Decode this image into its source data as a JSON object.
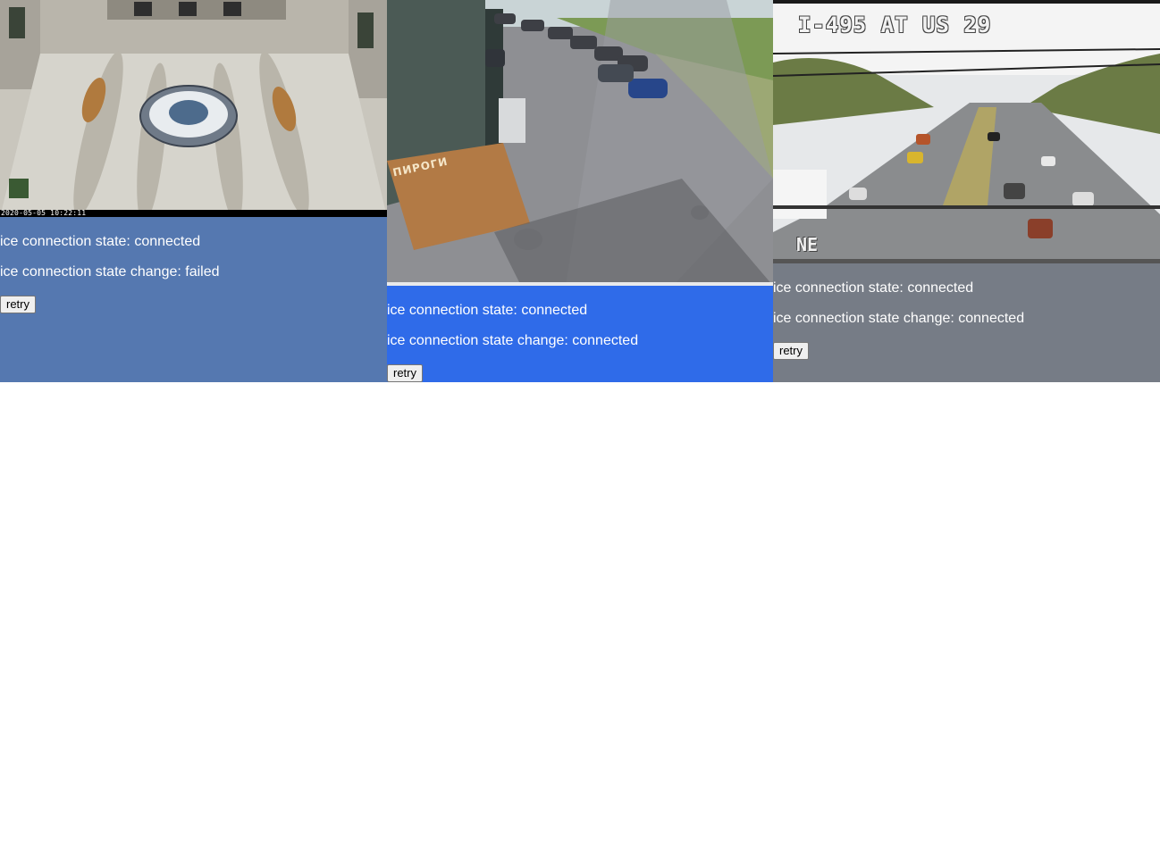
{
  "panels": [
    {
      "background": "#5578b0",
      "camera_scene": "station-hall-interior",
      "overlay": {
        "timestamp": "2020-05-05 10:22:11"
      },
      "state_text": "ice connection state: connected",
      "change_text": "ice connection state change: failed",
      "retry_label": "retry"
    },
    {
      "background": "#2f6be9",
      "camera_scene": "parking-lot-with-cars",
      "overlay": {
        "sign_text": "ПИРОГИ"
      },
      "state_text": "ice connection state: connected",
      "change_text": "ice connection state change: connected",
      "retry_label": "retry"
    },
    {
      "background": "#767c86",
      "camera_scene": "highway-traffic",
      "overlay": {
        "title": "I-495 AT US 29",
        "direction": "NE"
      },
      "state_text": "ice connection state: connected",
      "change_text": "ice connection state change: connected",
      "retry_label": "retry"
    }
  ]
}
